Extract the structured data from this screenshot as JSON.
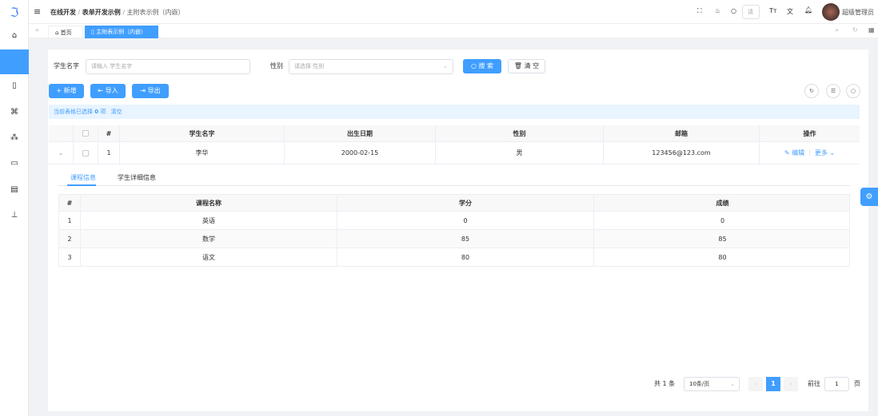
{
  "header": {
    "breadcrumb": [
      "在线开发",
      "表单开发示例",
      "主附表示例（内嵌）"
    ],
    "search_placeholder": "请",
    "user": "超级管理员"
  },
  "tabs": [
    {
      "label": "首页"
    },
    {
      "label": "主附表示例（内嵌）"
    }
  ],
  "search": {
    "name_label": "学生名字",
    "name_placeholder": "请输入 学生名字",
    "gender_label": "性别",
    "gender_placeholder": "请选择 性别",
    "search_btn": "搜 索",
    "clear_btn": "清 空"
  },
  "toolbar": {
    "add": "新增",
    "import": "导入",
    "export": "导出"
  },
  "alert": {
    "prefix": "当前表格已选择",
    "count": "0",
    "suffix": "项",
    "clear": "清空"
  },
  "table": {
    "headers": [
      "#",
      "学生名字",
      "出生日期",
      "性别",
      "邮箱",
      "操作"
    ],
    "rows": [
      {
        "index": "1",
        "name": "李华",
        "birth": "2000-02-15",
        "gender": "男",
        "email": "123456@123.com",
        "edit": "编辑",
        "more": "更多"
      }
    ]
  },
  "sub": {
    "tabs": [
      "课程信息",
      "学生详细信息"
    ],
    "headers": [
      "#",
      "课程名称",
      "学分",
      "成绩"
    ],
    "rows": [
      [
        "1",
        "英语",
        "0",
        "0"
      ],
      [
        "2",
        "数学",
        "85",
        "85"
      ],
      [
        "3",
        "语文",
        "80",
        "80"
      ]
    ]
  },
  "pagination": {
    "total": "共 1 条",
    "page_size": "10条/页",
    "current": "1",
    "goto": "前往",
    "goto_value": "1",
    "page_unit": "页"
  },
  "colors": {
    "primary": "#409eff"
  }
}
